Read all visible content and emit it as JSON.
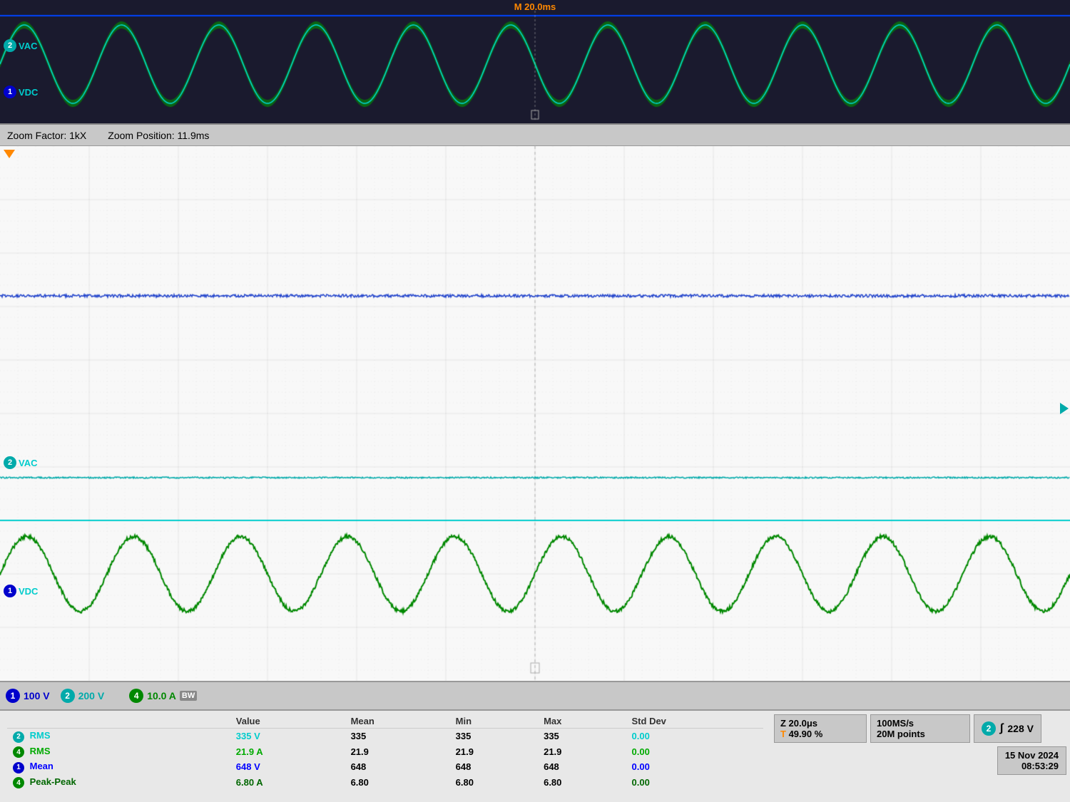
{
  "header": {
    "time_marker": "M 20.0ms"
  },
  "zoom_bar": {
    "zoom_factor": "Zoom Factor: 1kX",
    "zoom_position": "Zoom Position: 11.9ms"
  },
  "bottom_bar": {
    "ch1_label": "1",
    "ch1_value": "100 V",
    "ch2_label": "2",
    "ch2_value": "200 V",
    "ch4_label": "4",
    "ch4_value": "10.0 A",
    "bw": "BW"
  },
  "measurements": {
    "headers": [
      "",
      "Value",
      "Mean",
      "Min",
      "Max",
      "Std Dev"
    ],
    "rows": [
      {
        "label": "RMS",
        "ch": "2",
        "color": "cyan",
        "value": "335 V",
        "mean": "335",
        "min": "335",
        "max": "335",
        "std": "0.00"
      },
      {
        "label": "RMS",
        "ch": "4",
        "color": "green",
        "value": "21.9 A",
        "mean": "21.9",
        "min": "21.9",
        "max": "21.9",
        "std": "0.00"
      },
      {
        "label": "Mean",
        "ch": "1",
        "color": "blue",
        "value": "648 V",
        "mean": "648",
        "min": "648",
        "max": "648",
        "std": "0.00"
      },
      {
        "label": "Peak-Peak",
        "ch": "4",
        "color": "dark-green",
        "value": "6.80 A",
        "mean": "6.80",
        "min": "6.80",
        "max": "6.80",
        "std": "0.00"
      }
    ]
  },
  "right_panels": {
    "z_label": "Z 20.0μs",
    "z_percent": "49.90 %",
    "z_percent_label": "T",
    "sample_rate": "100MS/s",
    "sample_points": "20M points",
    "ch2_label": "2",
    "sig_symbol": "∫",
    "sig_value": "228 V",
    "date": "15 Nov 2024",
    "time": "08:53:29"
  },
  "channel_labels": {
    "overview_ch2": "VAC",
    "overview_ch1": "VDC",
    "main_ch2": "VAC",
    "main_ch1": "VDC"
  },
  "channel_numbers": {
    "ch2_overview": "2",
    "ch1_overview": "1",
    "ch2_main": "2",
    "ch1_main": "1"
  }
}
